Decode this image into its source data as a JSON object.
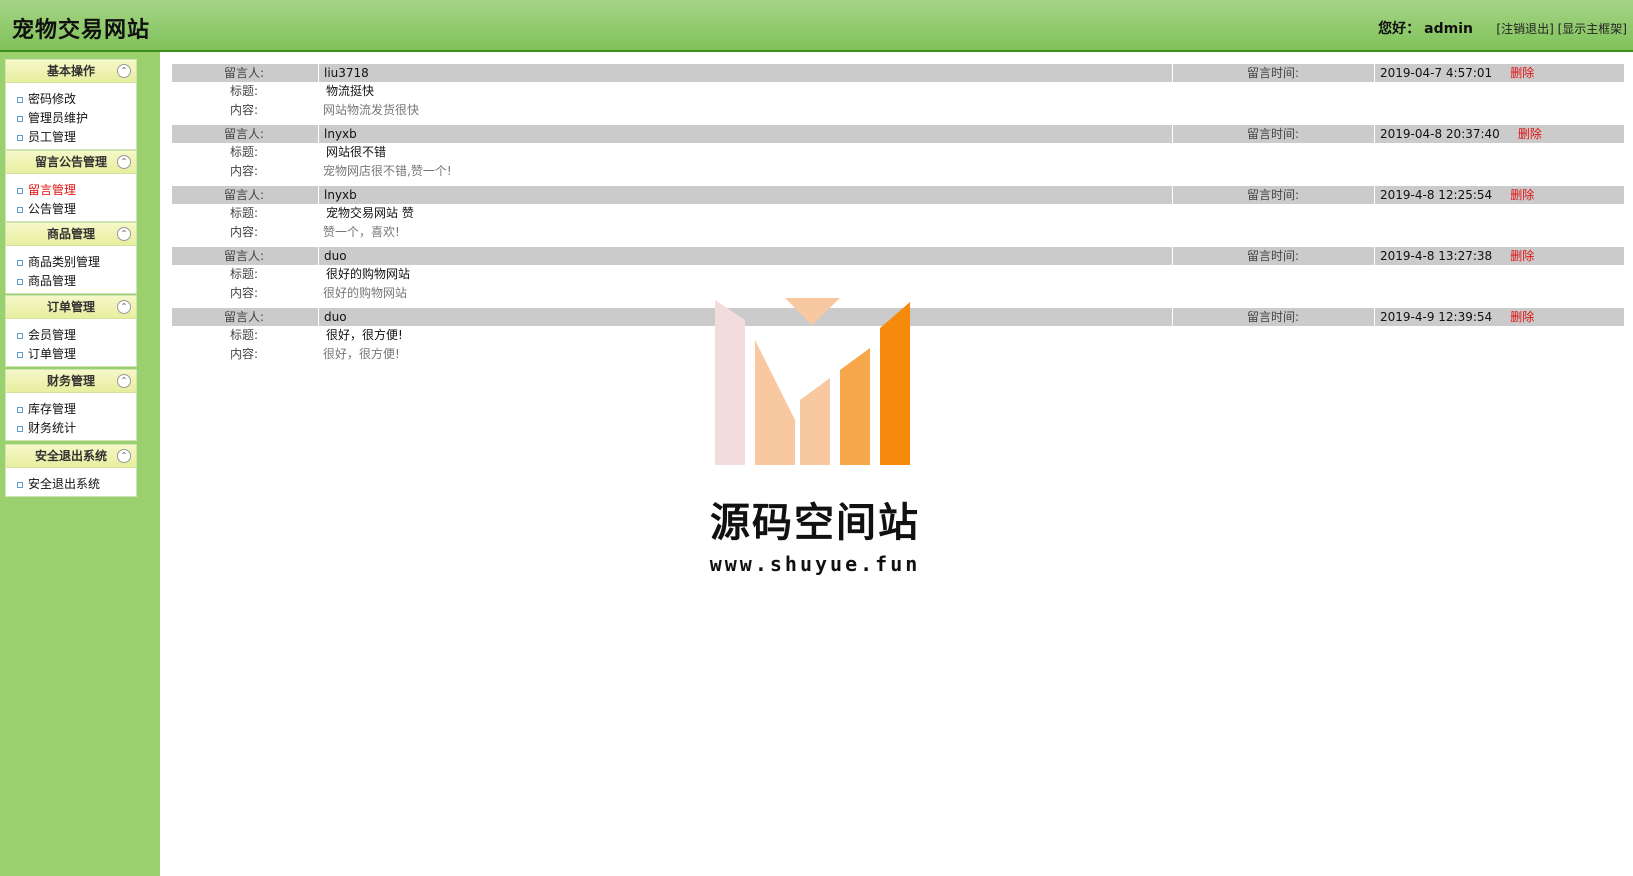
{
  "header": {
    "title": "宠物交易网站",
    "greeting": "您好：",
    "username": "admin",
    "logout": "[注销退出]",
    "show_frame": "[显示主框架]"
  },
  "sidebar": {
    "groups": [
      {
        "title": "基本操作",
        "items": [
          "密码修改",
          "管理员维护",
          "员工管理"
        ]
      },
      {
        "title": "留言公告管理",
        "items": [
          "留言管理",
          "公告管理"
        ]
      },
      {
        "title": "商品管理",
        "items": [
          "商品类别管理",
          "商品管理"
        ]
      },
      {
        "title": "订单管理",
        "items": [
          "会员管理",
          "订单管理"
        ]
      },
      {
        "title": "财务管理",
        "items": [
          "库存管理",
          "财务统计"
        ]
      },
      {
        "title": "安全退出系统",
        "items": [
          "安全退出系统"
        ]
      }
    ],
    "active_item": "留言管理"
  },
  "labels": {
    "author": "留言人:",
    "time": "留言时间:",
    "title": "标题:",
    "content": "内容:",
    "delete": "删除"
  },
  "messages": [
    {
      "author": "liu3718",
      "time": "2019-04-7 4:57:01",
      "title": "物流挺快",
      "content": "网站物流发货很快"
    },
    {
      "author": "lnyxb",
      "time": "2019-04-8 20:37:40",
      "title": "网站很不错",
      "content": "宠物网店很不错,赞一个!"
    },
    {
      "author": "lnyxb",
      "time": "2019-4-8 12:25:54",
      "title": "宠物交易网站 赞",
      "content": "赞一个，喜欢!"
    },
    {
      "author": "duo",
      "time": "2019-4-8 13:27:38",
      "title": "很好的购物网站",
      "content": "很好的购物网站"
    },
    {
      "author": "duo",
      "time": "2019-4-9 12:39:54",
      "title": "很好，很方便!",
      "content": "很好，很方便!"
    }
  ],
  "watermark": {
    "name": "源码空间站",
    "url": "www.shuyue.fun",
    "colors": [
      "#f2dcdc",
      "#f8c8a0",
      "#f7a64a",
      "#f58a0c"
    ]
  }
}
